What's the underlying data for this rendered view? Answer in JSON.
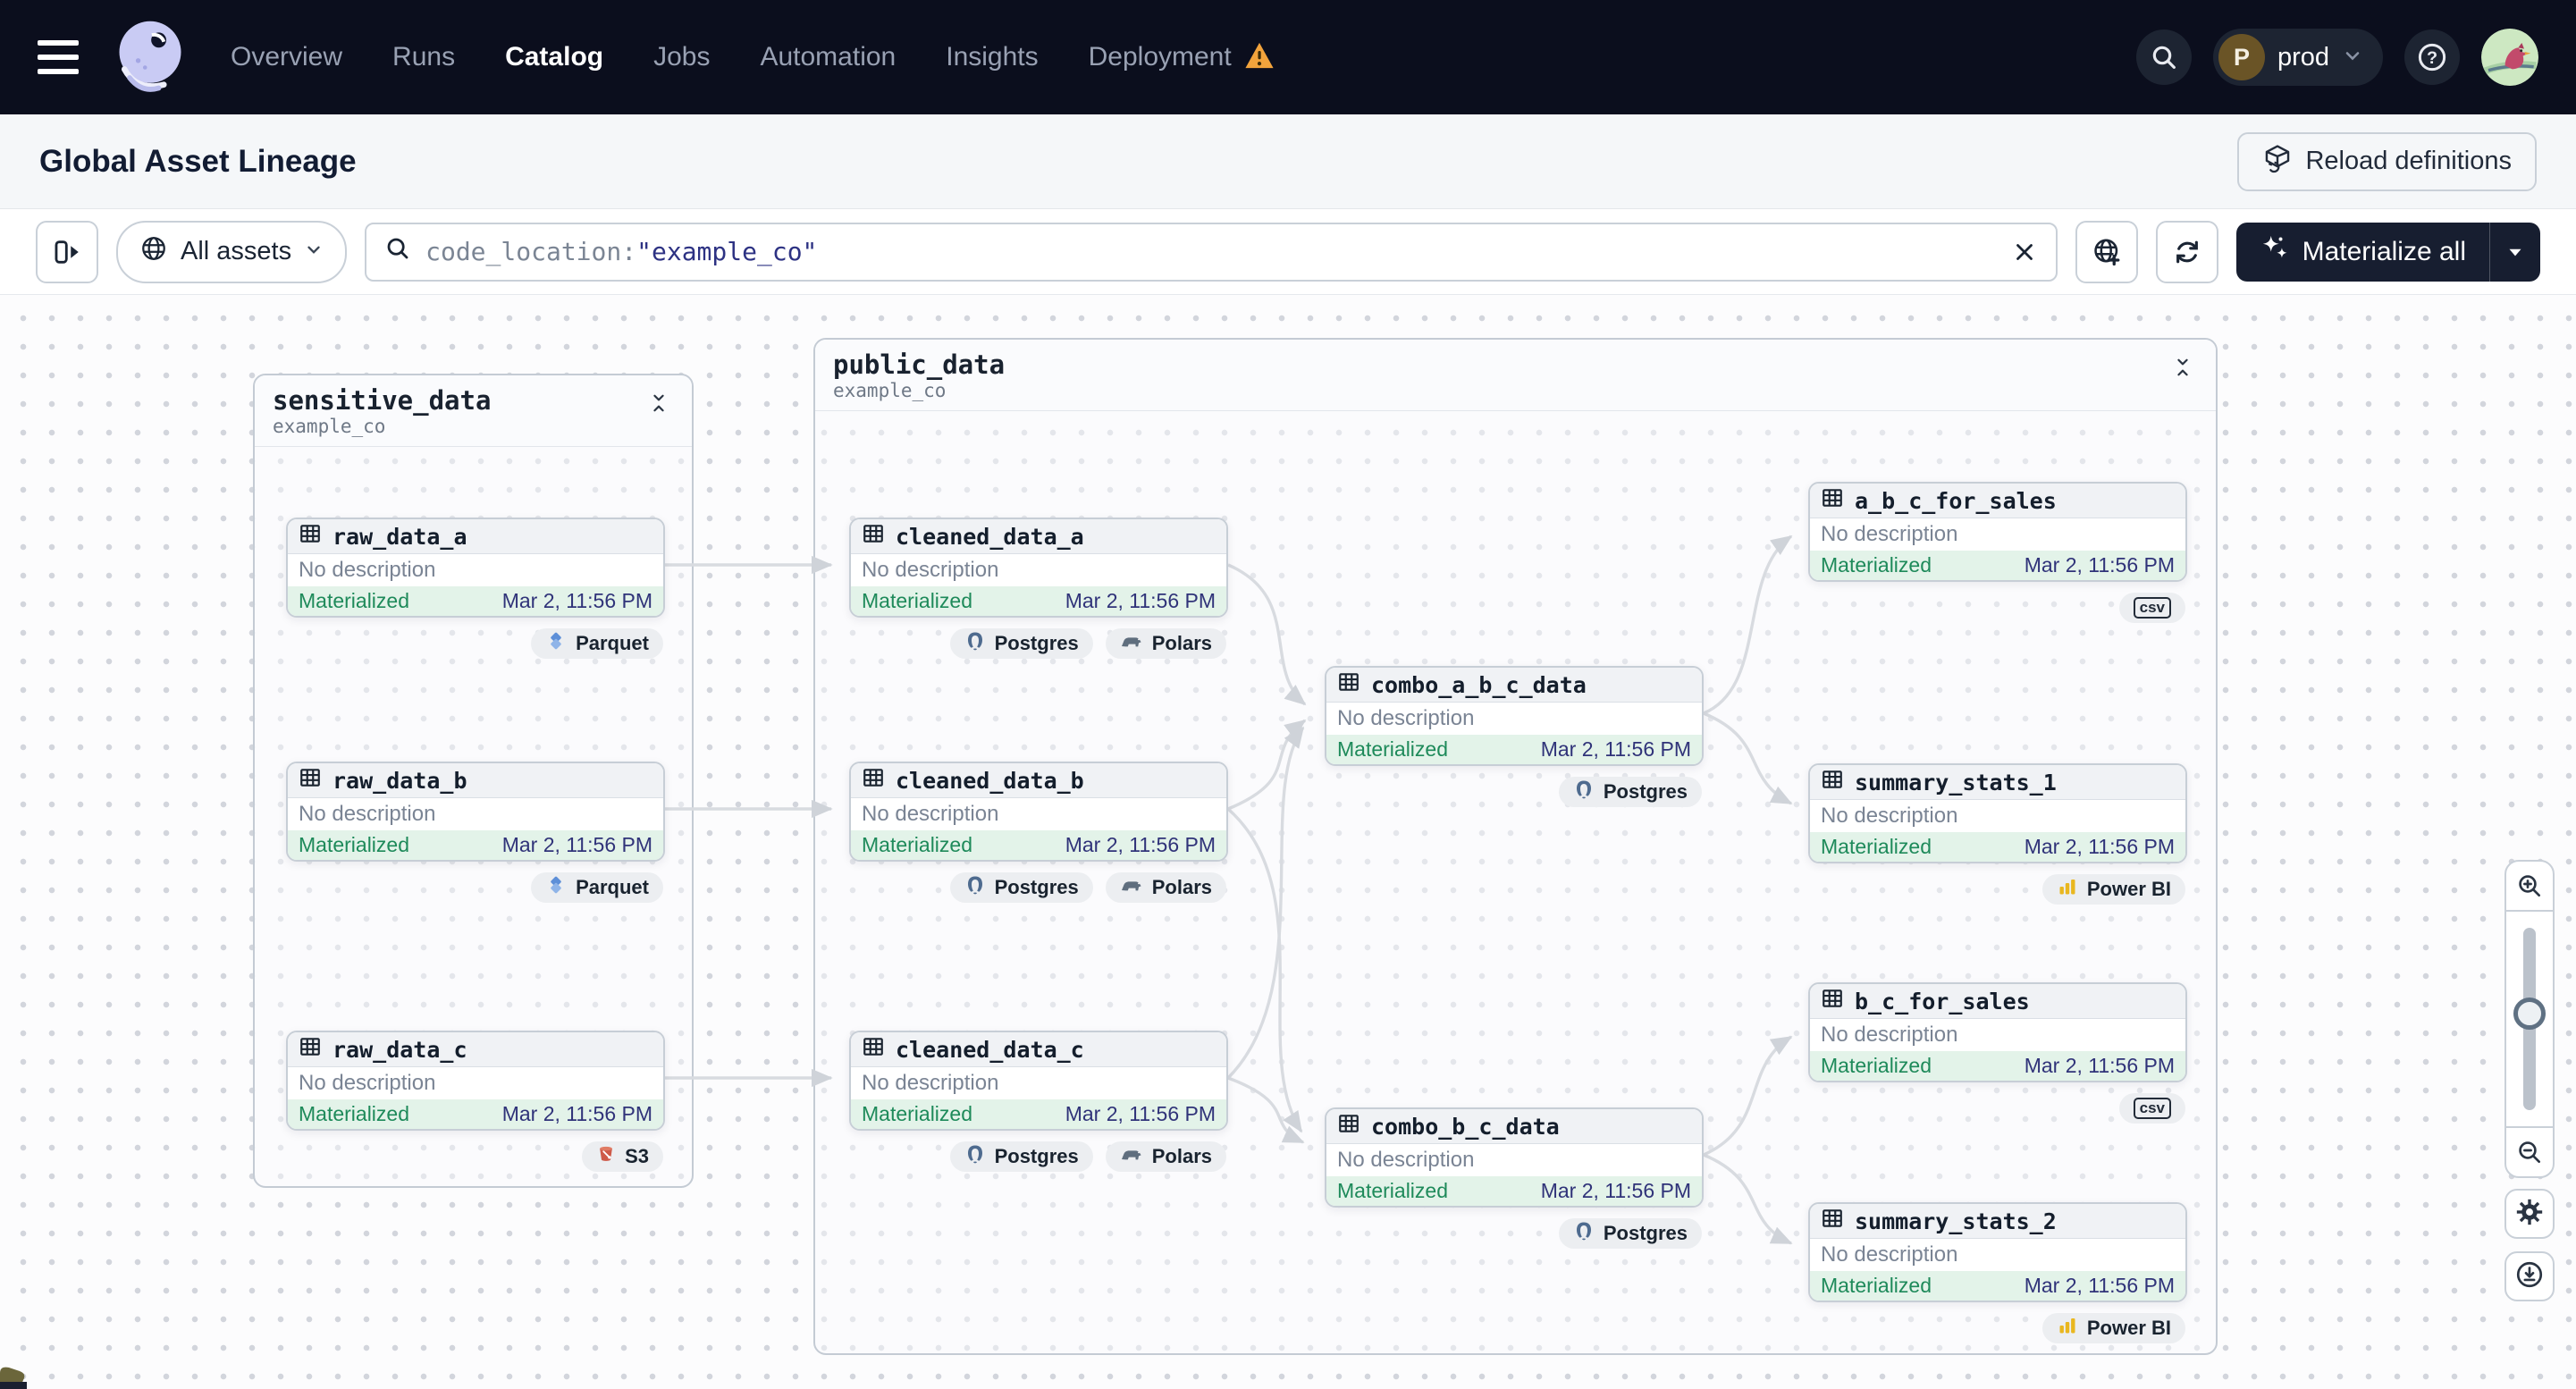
{
  "nav": {
    "links": [
      {
        "label": "Overview"
      },
      {
        "label": "Runs"
      },
      {
        "label": "Catalog",
        "active": true
      },
      {
        "label": "Jobs"
      },
      {
        "label": "Automation"
      },
      {
        "label": "Insights"
      },
      {
        "label": "Deployment",
        "warning": true
      }
    ],
    "environment": {
      "initial": "P",
      "label": "prod"
    }
  },
  "page_header": {
    "title": "Global Asset Lineage",
    "reload_button": "Reload definitions"
  },
  "toolbar": {
    "scope_button": "All assets",
    "search": {
      "field": "code_location:",
      "value": "\"example_co\""
    },
    "materialize_button": "Materialize all"
  },
  "graph": {
    "groups": [
      {
        "name": "sensitive_data",
        "location": "example_co"
      },
      {
        "name": "public_data",
        "location": "example_co"
      }
    ],
    "nodes": [
      {
        "name": "raw_data_a",
        "description": "No description",
        "status": "Materialized",
        "timestamp": "Mar 2, 11:56 PM",
        "tags": [
          {
            "icon": "parquet-icon",
            "label": "Parquet"
          }
        ]
      },
      {
        "name": "raw_data_b",
        "description": "No description",
        "status": "Materialized",
        "timestamp": "Mar 2, 11:56 PM",
        "tags": [
          {
            "icon": "parquet-icon",
            "label": "Parquet"
          }
        ]
      },
      {
        "name": "raw_data_c",
        "description": "No description",
        "status": "Materialized",
        "timestamp": "Mar 2, 11:56 PM",
        "tags": [
          {
            "icon": "s3-icon",
            "label": "S3"
          }
        ]
      },
      {
        "name": "cleaned_data_a",
        "description": "No description",
        "status": "Materialized",
        "timestamp": "Mar 2, 11:56 PM",
        "tags": [
          {
            "icon": "postgres-icon",
            "label": "Postgres"
          },
          {
            "icon": "polars-icon",
            "label": "Polars"
          }
        ]
      },
      {
        "name": "cleaned_data_b",
        "description": "No description",
        "status": "Materialized",
        "timestamp": "Mar 2, 11:56 PM",
        "tags": [
          {
            "icon": "postgres-icon",
            "label": "Postgres"
          },
          {
            "icon": "polars-icon",
            "label": "Polars"
          }
        ]
      },
      {
        "name": "cleaned_data_c",
        "description": "No description",
        "status": "Materialized",
        "timestamp": "Mar 2, 11:56 PM",
        "tags": [
          {
            "icon": "postgres-icon",
            "label": "Postgres"
          },
          {
            "icon": "polars-icon",
            "label": "Polars"
          }
        ]
      },
      {
        "name": "combo_a_b_c_data",
        "description": "No description",
        "status": "Materialized",
        "timestamp": "Mar 2, 11:56 PM",
        "tags": [
          {
            "icon": "postgres-icon",
            "label": "Postgres"
          }
        ]
      },
      {
        "name": "combo_b_c_data",
        "description": "No description",
        "status": "Materialized",
        "timestamp": "Mar 2, 11:56 PM",
        "tags": [
          {
            "icon": "postgres-icon",
            "label": "Postgres"
          }
        ]
      },
      {
        "name": "a_b_c_for_sales",
        "description": "No description",
        "status": "Materialized",
        "timestamp": "Mar 2, 11:56 PM",
        "tags": [
          {
            "icon": "csv-icon",
            "label": "csv"
          }
        ]
      },
      {
        "name": "summary_stats_1",
        "description": "No description",
        "status": "Materialized",
        "timestamp": "Mar 2, 11:56 PM",
        "tags": [
          {
            "icon": "powerbi-icon",
            "label": "Power BI"
          }
        ]
      },
      {
        "name": "b_c_for_sales",
        "description": "No description",
        "status": "Materialized",
        "timestamp": "Mar 2, 11:56 PM",
        "tags": [
          {
            "icon": "csv-icon",
            "label": "csv"
          }
        ]
      },
      {
        "name": "summary_stats_2",
        "description": "No description",
        "status": "Materialized",
        "timestamp": "Mar 2, 11:56 PM",
        "tags": [
          {
            "icon": "powerbi-icon",
            "label": "Power BI"
          }
        ]
      }
    ],
    "edges": [
      {
        "from": "raw_data_a",
        "to": "cleaned_data_a"
      },
      {
        "from": "raw_data_b",
        "to": "cleaned_data_b"
      },
      {
        "from": "raw_data_c",
        "to": "cleaned_data_c"
      },
      {
        "from": "cleaned_data_a",
        "to": "combo_a_b_c_data"
      },
      {
        "from": "cleaned_data_b",
        "to": "combo_a_b_c_data"
      },
      {
        "from": "cleaned_data_c",
        "to": "combo_a_b_c_data"
      },
      {
        "from": "cleaned_data_b",
        "to": "combo_b_c_data"
      },
      {
        "from": "cleaned_data_c",
        "to": "combo_b_c_data"
      },
      {
        "from": "combo_a_b_c_data",
        "to": "a_b_c_for_sales"
      },
      {
        "from": "combo_a_b_c_data",
        "to": "summary_stats_1"
      },
      {
        "from": "combo_b_c_data",
        "to": "b_c_for_sales"
      },
      {
        "from": "combo_b_c_data",
        "to": "summary_stats_2"
      }
    ]
  },
  "colors": {
    "nav_bg": "#0B0E1D",
    "accent_dark": "#171E30",
    "materialized_green": "#1E8A5A",
    "materialized_bg": "#E3F3E9",
    "timestamp_blue": "#303379",
    "edge_gray": "#D8DBE0",
    "warning_orange": "#F2A33C"
  },
  "icons": [
    "menu-icon",
    "dagster-logo",
    "warning-icon",
    "search-icon",
    "help-icon",
    "chevron-down-icon",
    "reload-icon",
    "panel-toggle-icon",
    "globe-icon",
    "clear-icon",
    "add-location-icon",
    "refresh-icon",
    "sparkle-icon",
    "table-icon",
    "collapse-icon",
    "zoom-in-icon",
    "zoom-out-icon",
    "gear-icon",
    "download-icon"
  ]
}
